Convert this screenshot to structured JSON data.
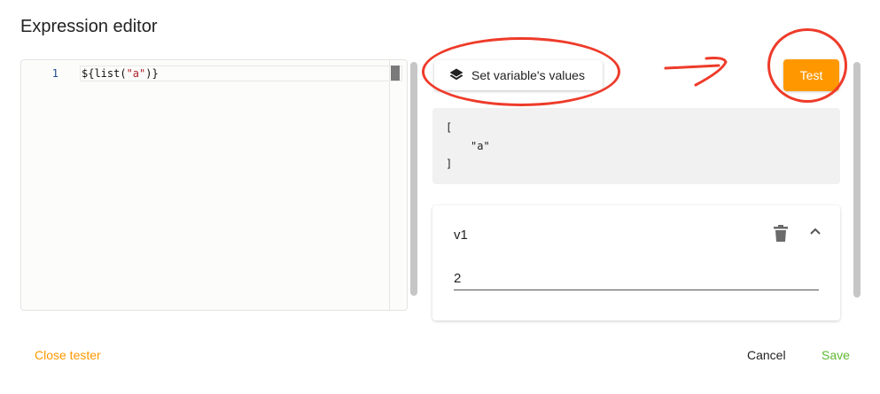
{
  "dialog": {
    "title": "Expression editor"
  },
  "editor": {
    "line_number": "1",
    "code_prefix": "${list(",
    "code_string": "\"a\"",
    "code_suffix": ")}"
  },
  "toolbar": {
    "set_values_label": "Set variable's values",
    "set_values_icon": "layers-icon",
    "test_label": "Test"
  },
  "result": {
    "lines": [
      "[",
      "\"a\"",
      "]"
    ]
  },
  "variable": {
    "name": "v1",
    "value": "2",
    "delete_icon": "trash-icon",
    "collapse_icon": "chevron-up-icon"
  },
  "footer": {
    "close_tester_label": "Close tester",
    "cancel_label": "Cancel",
    "save_label": "Save"
  },
  "colors": {
    "accent": "#ff9800",
    "save": "#5fb832",
    "annotation": "#ee3b2a"
  }
}
